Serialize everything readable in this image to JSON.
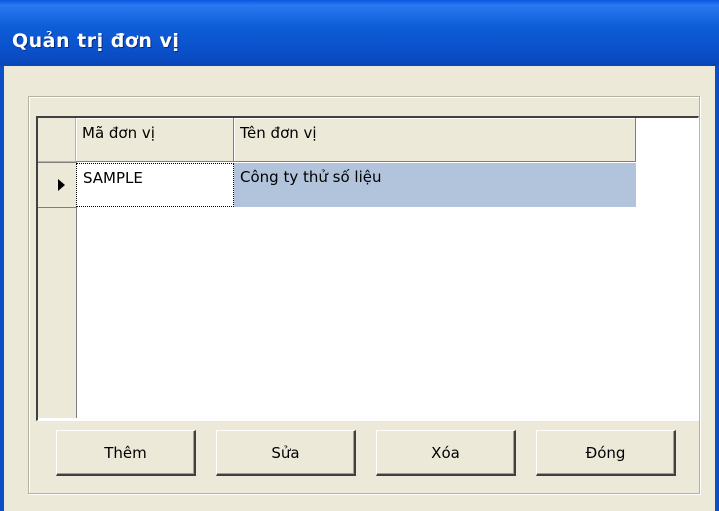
{
  "window": {
    "title": "Quản trị đơn vị"
  },
  "grid": {
    "columns": [
      "Mã đơn vị",
      "Tên đơn vị"
    ],
    "rows": [
      {
        "code": "SAMPLE",
        "name": "Công ty thử số liệu"
      }
    ]
  },
  "buttons": {
    "add": "Thêm",
    "edit": "Sửa",
    "delete": "Xóa",
    "close": "Đóng"
  },
  "colors": {
    "titlebar": "#0a4fc8",
    "selection": "#b2c3dc",
    "face": "#ece9d8"
  }
}
